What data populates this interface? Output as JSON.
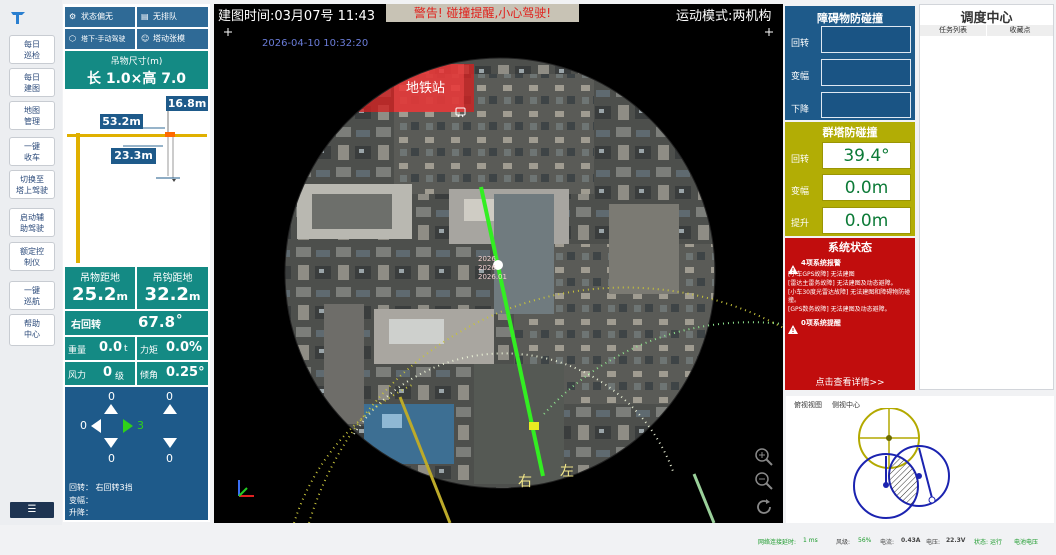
{
  "nav": {
    "items": [
      "每日\n巡检",
      "每日\n建图",
      "地图\n管理",
      "一键\n收车",
      "切换至\n塔上驾驶",
      "启动辅\n助驾驶",
      "额定控\n制仪",
      "一键\n巡航",
      "帮助\n中心"
    ],
    "menu_glyph": "☰"
  },
  "left_panel": {
    "mode1": "状态偏无",
    "mode2": "无排队",
    "mode3": "塔下-手动驾驶",
    "mode4": "塔动张模",
    "load_size_title": "吊物尺寸(m)",
    "load_size_value": "长 1.0×高 7.0",
    "dim_16": "16.8m",
    "dim_53": "53.2m",
    "dim_23": "23.3m",
    "load_dist_label": "吊物距地",
    "hook_dist_label": "吊钩距地",
    "load_dist_value": "25.2",
    "hook_dist_value": "32.2",
    "unit_m": "m",
    "rotate_label": "右回转",
    "rotate_value": "67.8",
    "rotate_unit": "°",
    "weight_label": "重量",
    "weight_value": "0.0",
    "weight_unit": "t",
    "moment_label": "力矩",
    "moment_value": "0.0%",
    "wind_label": "风力",
    "wind_value": "0",
    "wind_unit": "级",
    "tilt_label": "倾角",
    "tilt_value": "0.25°",
    "joy_left_top": "0",
    "joy_left_left": "0",
    "joy_left_right": "3",
    "joy_left_bottom": "0",
    "joy_right_top": "0",
    "joy_right_bottom": "0",
    "footer_rotate": "回转：  右回转3挡",
    "footer_luff": "变幅：",
    "footer_hoist": "升降："
  },
  "map": {
    "build_time": "建图时间:03月07号 11:43",
    "warning": "警告! 碰撞提醒,小心驾驶!",
    "motion_mode": "运动模式:两机构",
    "timestamp": "2026-04-10 10:32:20",
    "station": "地铁站",
    "overlay_a": "2026",
    "overlay_b": "2026",
    "overlay_c": "2026.01",
    "label_right": "右",
    "label_left": "左"
  },
  "obstacle": {
    "title": "障碍物防碰撞",
    "rotate": "回转",
    "luff": "变幅",
    "down": "下降",
    "rotate_value": "",
    "luff_value": "",
    "down_value": ""
  },
  "group": {
    "title": "群塔防碰撞",
    "rotate": "回转",
    "luff": "变幅",
    "lift": "提升",
    "rotate_value": "39.4°",
    "luff_value": "0.0m",
    "lift_value": "0.0m"
  },
  "system": {
    "title": "系统状态",
    "alarm_head": "4项系统报警",
    "alarms": [
      "[小车GPS故障] 无法建图",
      "[雷达主雷务故障] 无法建图及动态避障。",
      "[小车30度光雷达故障] 无法建图和障碍物防碰撞。",
      "[GPS数务故障] 无法建图及动态避障。"
    ],
    "reminder_head": "0项系统提醒",
    "details_link": "点击查看详情>>"
  },
  "dispatch": {
    "title": "调度中心",
    "col1": "任务列表",
    "col2": "收藏点"
  },
  "mini_tabs": {
    "tab1": "俯视视图",
    "tab2": "侧视中心"
  },
  "status_bar": {
    "net_label": "网络连接延时:",
    "net_value": "1 ms",
    "wind_label": "风级:",
    "wind_value": "56%",
    "current_label": "电流:",
    "current_value": "0.43A",
    "voltage_label": "电压:",
    "voltage_value": "22.3V",
    "state_label": "状态:",
    "state_value": "运行",
    "power_label": "电池电压",
    "power_value": ""
  },
  "colors": {
    "teal": "#148a84",
    "blue": "#1e5a8a",
    "yellow_panel": "#b2ad05",
    "red_panel": "#c10d0d",
    "warning_bg": "#c8c3b5",
    "warning_text": "#e0211c",
    "green_value": "#0c7a37"
  }
}
